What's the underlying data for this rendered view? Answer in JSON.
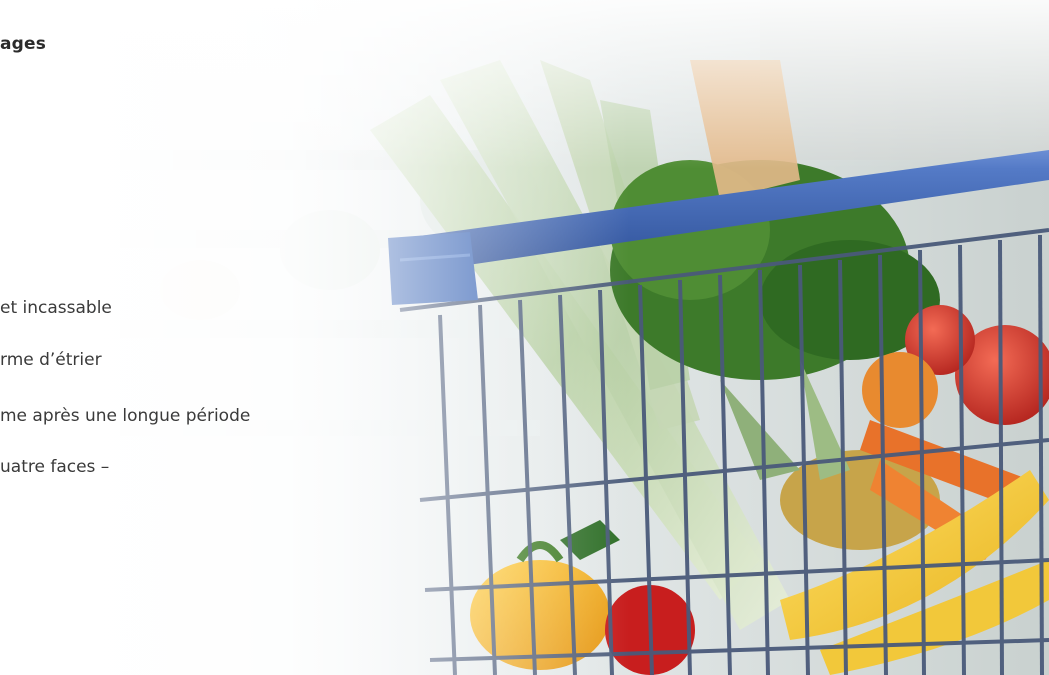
{
  "page": {
    "heading": "ages",
    "features": [
      {
        "text": "et incassable"
      },
      {
        "text": "rme d’étrier"
      },
      {
        "text": "me après une longue période"
      },
      {
        "text": "uatre faces –"
      }
    ]
  },
  "photo": {
    "subject": "shopping cart with fresh produce in a supermarket aisle",
    "colors": {
      "cart_frame": "#4a5a7a",
      "cart_handle": "#3f66b5",
      "accent_orange": "#e8822a"
    }
  }
}
